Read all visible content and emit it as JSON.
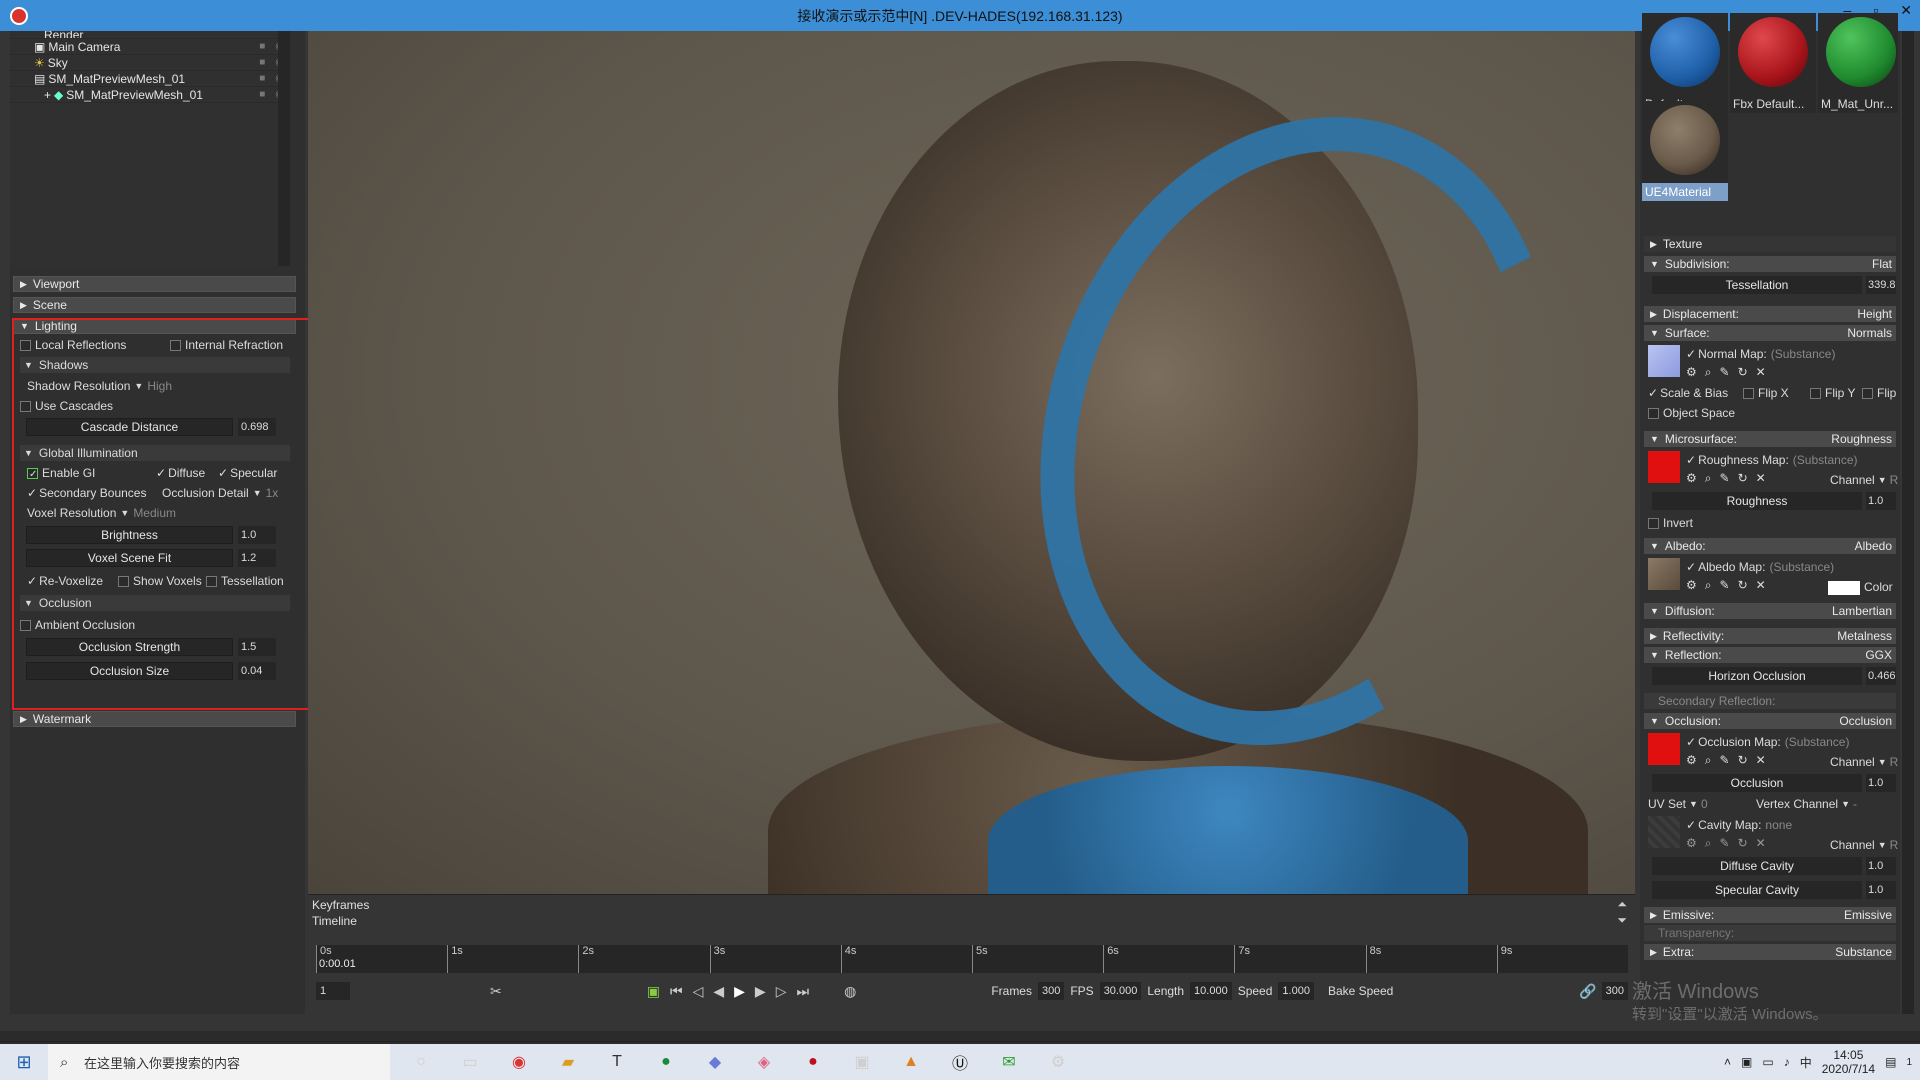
{
  "window": {
    "title": "接收演示或示范中[N] .DEV-HADES(192.168.31.123)"
  },
  "tree": {
    "items": [
      "Render",
      "Main Camera",
      "Sky",
      "SM_MatPreviewMesh_01",
      "SM_MatPreviewMesh_01"
    ]
  },
  "left": {
    "viewport": "Viewport",
    "scene": "Scene",
    "lighting": "Lighting",
    "local_reflections": "Local Reflections",
    "internal_refraction": "Internal Refraction",
    "shadows": "Shadows",
    "shadow_resolution": "Shadow Resolution",
    "shadow_resolution_value": "High",
    "use_cascades": "Use Cascades",
    "cascade_distance": "Cascade Distance",
    "cascade_distance_value": "0.698",
    "global_illumination": "Global Illumination",
    "enable_gi": "Enable GI",
    "diffuse": "Diffuse",
    "specular": "Specular",
    "secondary_bounces": "Secondary Bounces",
    "occlusion_detail": "Occlusion Detail",
    "occlusion_detail_value": "1x",
    "voxel_resolution": "Voxel Resolution",
    "voxel_resolution_value": "Medium",
    "brightness": "Brightness",
    "brightness_value": "1.0",
    "voxel_scene_fit": "Voxel Scene Fit",
    "voxel_scene_fit_value": "1.2",
    "re_voxelize": "Re-Voxelize",
    "show_voxels": "Show Voxels",
    "tessellation": "Tessellation",
    "occlusion": "Occlusion",
    "ambient_occlusion": "Ambient Occlusion",
    "occlusion_strength": "Occlusion Strength",
    "occlusion_strength_value": "1.5",
    "occlusion_size": "Occlusion Size",
    "occlusion_size_value": "0.04",
    "watermark": "Watermark"
  },
  "timeline": {
    "keyframes": "Keyframes",
    "timeline": "Timeline",
    "current_time": "0:00.01",
    "ticks": [
      "0s",
      "1s",
      "2s",
      "3s",
      "4s",
      "5s",
      "6s",
      "7s",
      "8s",
      "9s"
    ],
    "frame_field": "1",
    "frames_label": "Frames",
    "frames_value": "300",
    "fps_label": "FPS",
    "fps_value": "30.000",
    "length_label": "Length",
    "length_value": "10.000",
    "speed_label": "Speed",
    "speed_value": "1.000",
    "bake_speed": "Bake Speed",
    "end_frame": "300"
  },
  "right": {
    "materials": [
      {
        "label": "Default",
        "color": "#1e5fa8"
      },
      {
        "label": "Fbx Default...",
        "color": "#a8141a"
      },
      {
        "label": "M_Mat_Unr...",
        "color": "#1f8a2e"
      },
      {
        "label": "UE4Material",
        "color": "#6b5b4a"
      }
    ],
    "texture": "Texture",
    "subdivision": "Subdivision:",
    "subdivision_mode": "Flat",
    "tessellation": "Tessellation",
    "tessellation_value": "339.8",
    "displacement": "Displacement:",
    "displacement_mode": "Height",
    "surface": "Surface:",
    "surface_mode": "Normals",
    "normal_map": "Normal Map:",
    "substance": "(Substance)",
    "scale_bias": "Scale & Bias",
    "flip_x": "Flip X",
    "flip_y": "Flip Y",
    "flip": "Flip",
    "object_space": "Object Space",
    "microsurface": "Microsurface:",
    "microsurface_mode": "Roughness",
    "roughness_map": "Roughness Map:",
    "channel": "Channel",
    "channel_value": "R",
    "roughness": "Roughness",
    "roughness_value": "1.0",
    "invert": "Invert",
    "albedo": "Albedo:",
    "albedo_mode": "Albedo",
    "albedo_map": "Albedo Map:",
    "color": "Color",
    "diffusion": "Diffusion:",
    "diffusion_mode": "Lambertian",
    "reflectivity": "Reflectivity:",
    "reflectivity_mode": "Metalness",
    "reflection": "Reflection:",
    "reflection_mode": "GGX",
    "horizon_occlusion": "Horizon Occlusion",
    "horizon_occlusion_value": "0.466",
    "secondary_reflection": "Secondary Reflection:",
    "occlusion": "Occlusion:",
    "occlusion_mode": "Occlusion",
    "occlusion_map": "Occlusion Map:",
    "occlusion_label": "Occlusion",
    "occlusion_value": "1.0",
    "uv_set": "UV Set",
    "uv_set_value": "0",
    "vertex_channel": "Vertex Channel",
    "vertex_channel_value": "-",
    "cavity_map": "Cavity Map:",
    "cavity_none": "none",
    "diffuse_cavity": "Diffuse Cavity",
    "diffuse_cavity_value": "1.0",
    "specular_cavity": "Specular Cavity",
    "specular_cavity_value": "1.0",
    "emissive": "Emissive:",
    "emissive_mode": "Emissive",
    "transparency": "Transparency:",
    "extra": "Extra:",
    "extra_mode": "Substance"
  },
  "watermark": {
    "line1": "激活 Windows",
    "line2": "转到\"设置\"以激活 Windows。"
  },
  "taskbar": {
    "search_placeholder": "在这里输入你要搜索的内容",
    "ime": "中",
    "time": "14:05",
    "date": "2020/7/14",
    "notifications": "1"
  },
  "colors": {
    "titlebar": "#3c8fd6",
    "highlight_box": "#e02020",
    "accent_blue": "#2f74a6"
  }
}
